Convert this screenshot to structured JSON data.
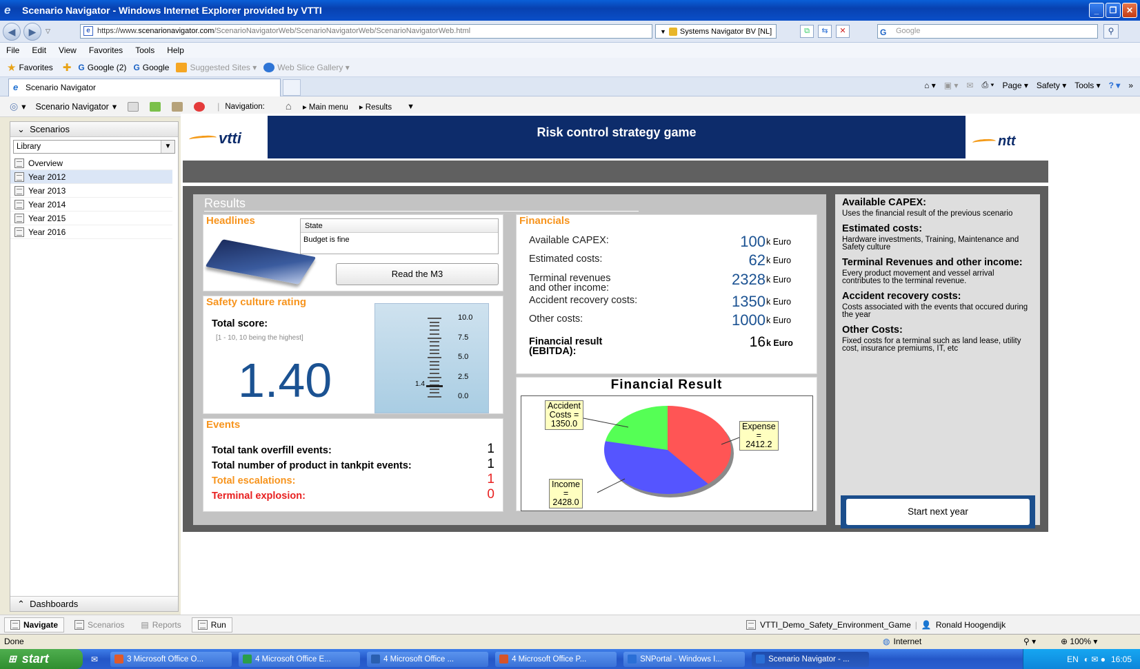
{
  "window": {
    "title": "Scenario Navigator - Windows Internet Explorer provided by VTTI",
    "buttons": [
      "_",
      "❐",
      "✕"
    ]
  },
  "addressbar": {
    "url_prefix": "https://www.",
    "url_domain": "scenarionavigator.com",
    "url_rest": "/ScenarioNavigatorWeb/ScenarioNavigatorWeb/ScenarioNavigatorWeb.html",
    "cert": "Systems Navigator BV [NL]",
    "search_placeholder": "Google"
  },
  "menu": [
    "File",
    "Edit",
    "View",
    "Favorites",
    "Tools",
    "Help"
  ],
  "favorites": {
    "label": "Favorites",
    "items": [
      "Google (2)",
      "Google",
      "Suggested Sites ▾",
      "Web Slice Gallery ▾"
    ]
  },
  "tab": {
    "label": "Scenario Navigator"
  },
  "command_bar": [
    "Page ▾",
    "Safety ▾",
    "Tools ▾"
  ],
  "app_toolbar": {
    "app_name": "Scenario Navigator",
    "nav_label": "Navigation:",
    "crumbs": [
      "Main menu",
      "Results"
    ]
  },
  "sidebar": {
    "header": "Scenarios",
    "library": "Library",
    "items": [
      {
        "label": "Overview",
        "selected": false
      },
      {
        "label": "Year 2012",
        "selected": true
      },
      {
        "label": "Year 2013",
        "selected": false
      },
      {
        "label": "Year 2014",
        "selected": false
      },
      {
        "label": "Year 2015",
        "selected": false
      },
      {
        "label": "Year 2016",
        "selected": false
      }
    ],
    "footer": "Dashboards"
  },
  "bottom_nav": {
    "tabs": [
      "Navigate",
      "Scenarios",
      "Reports",
      "Run"
    ],
    "project": "VTTI_Demo_Safety_Environment_Game",
    "user": "Ronald Hoogendijk"
  },
  "status": {
    "left": "Done",
    "zone": "Internet",
    "zoom": "100%"
  },
  "taskbar": {
    "start": "start",
    "buttons": [
      {
        "label": "3 Microsoft Office O...",
        "active": false
      },
      {
        "label": "4 Microsoft Office E...",
        "active": false
      },
      {
        "label": "4 Microsoft Office ...",
        "active": false
      },
      {
        "label": "4 Microsoft Office P...",
        "active": false
      },
      {
        "label": "SNPortal - Windows I...",
        "active": false
      },
      {
        "label": "Scenario Navigator - ...",
        "active": true
      }
    ],
    "lang": "EN",
    "time": "16:05"
  },
  "banner": {
    "title": "Risk control strategy game",
    "left_logo": "vtti",
    "right_logo": "ntt"
  },
  "results": {
    "title": "Results",
    "headlines": {
      "title": "Headlines",
      "state_header": "State",
      "state_value": "Budget is fine",
      "button": "Read the M3"
    },
    "safety": {
      "title": "Safety culture rating",
      "total_label": "Total score:",
      "range_note": "[1 - 10, 10 being the highest]",
      "score": "1.40",
      "score_value": 1.4,
      "gauge_labels": [
        "10.0",
        "7.5",
        "5.0",
        "2.5",
        "0.0"
      ],
      "needle_label": "1.4"
    },
    "events": {
      "title": "Events",
      "rows": [
        {
          "label": "Total tank overfill events:",
          "value": "1",
          "style": "normal"
        },
        {
          "label": "Total number of product in tankpit events:",
          "value": "1",
          "style": "normal"
        },
        {
          "label": "Total escalations:",
          "value": "1",
          "style": "orange"
        },
        {
          "label": "Terminal explosion:",
          "value": "0",
          "style": "red"
        }
      ]
    },
    "financials": {
      "title": "Financials",
      "rows": [
        {
          "label1": "Available CAPEX:",
          "label2": "",
          "value": "100",
          "unit": "k Euro",
          "bold": false
        },
        {
          "label1": "Estimated costs:",
          "label2": "",
          "value": "62",
          "unit": "k Euro",
          "bold": false
        },
        {
          "label1": "Terminal revenues",
          "label2": "and other income:",
          "value": "2328",
          "unit": "k Euro",
          "bold": false
        },
        {
          "label1": "Accident recovery costs:",
          "label2": "",
          "value": "1350",
          "unit": "k Euro",
          "bold": false
        },
        {
          "label1": "Other costs:",
          "label2": "",
          "value": "1000",
          "unit": "k Euro",
          "bold": false
        },
        {
          "label1": "Financial result",
          "label2": "(EBITDA):",
          "value": "16",
          "unit": "k Euro",
          "bold": true
        }
      ]
    }
  },
  "chart_data": {
    "type": "pie",
    "title": "Financial Result",
    "slices": [
      {
        "label": "Expense",
        "value": 2412.2,
        "color": "#ff5555"
      },
      {
        "label": "Income",
        "value": 2428.0,
        "color": "#5555ff"
      },
      {
        "label": "Accident Costs",
        "value": 1350.0,
        "color": "#55ff55"
      }
    ],
    "callouts": {
      "accident": [
        "Accident",
        "Costs =",
        "1350.0"
      ],
      "expense": [
        "Expense",
        "=",
        "2412.2"
      ],
      "income": [
        "Income",
        "=",
        "2428.0"
      ]
    }
  },
  "info": {
    "sections": [
      {
        "heading": "Available CAPEX:",
        "text": "Uses the financial result of the previous scenario"
      },
      {
        "heading": "Estimated costs:",
        "text": "Hardware investments, Training, Maintenance and Safety culture"
      },
      {
        "heading": "Terminal Revenues and other income:",
        "text": "Every product movement and vessel arrival contributes to the terminal revenue."
      },
      {
        "heading": "Accident recovery costs:",
        "text": "Costs associated with the events that occured during the year"
      },
      {
        "heading": "Other Costs:",
        "text": "Fixed costs for a terminal such as land lease, utility cost, insurance premiums, IT, etc"
      }
    ],
    "next_button": "Start next year"
  },
  "colors": {
    "accent_orange": "#f7941d",
    "value_blue": "#1b5292",
    "banner_navy": "#0d2c6b"
  }
}
